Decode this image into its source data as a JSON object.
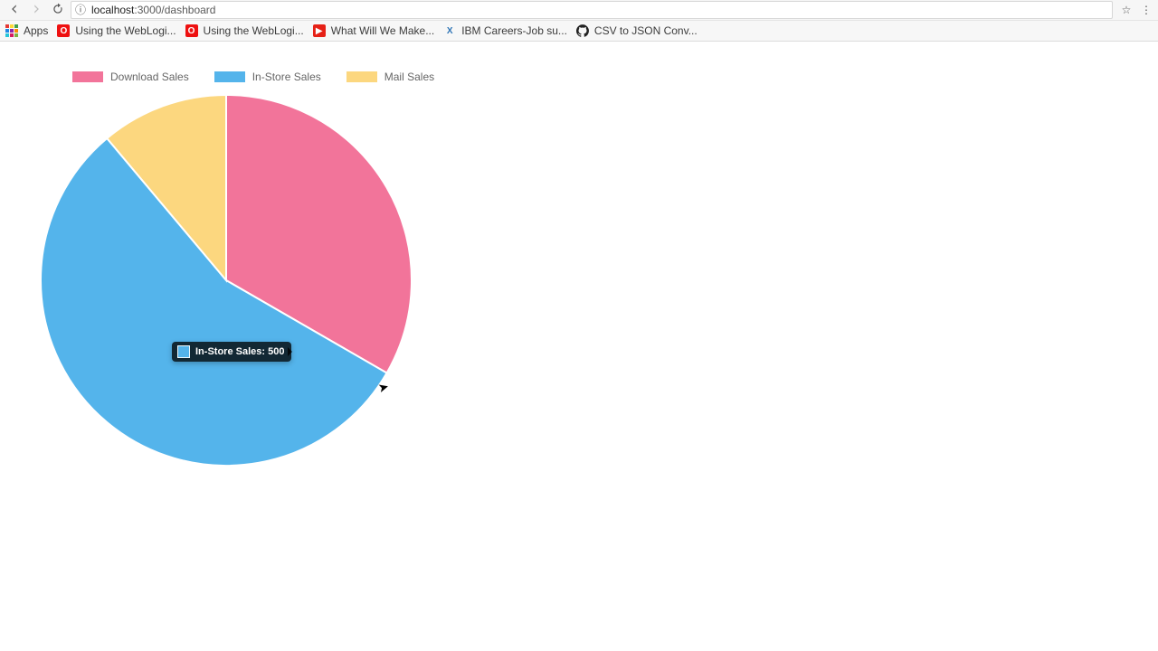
{
  "browser": {
    "url_host": "localhost",
    "url_port_path": ":3000/dashboard",
    "bookmarks": [
      {
        "label": "Apps",
        "kind": "apps"
      },
      {
        "label": "Using the WebLogi...",
        "kind": "oracle"
      },
      {
        "label": "Using the WebLogi...",
        "kind": "oracle"
      },
      {
        "label": "What Will We Make...",
        "kind": "youtube"
      },
      {
        "label": "IBM Careers-Job su...",
        "kind": "x"
      },
      {
        "label": "CSV to JSON Conv...",
        "kind": "github"
      }
    ]
  },
  "legend": [
    {
      "label": "Download Sales",
      "color": "#f2749a"
    },
    {
      "label": "In-Store Sales",
      "color": "#54b4eb"
    },
    {
      "label": "Mail Sales",
      "color": "#fcd77f"
    }
  ],
  "tooltip": {
    "label": "In-Store Sales",
    "value": "500",
    "swatch": "#54b4eb"
  },
  "chart_data": {
    "type": "pie",
    "series": [
      {
        "name": "Download Sales",
        "value": 300,
        "color": "#f2749a"
      },
      {
        "name": "In-Store Sales",
        "value": 500,
        "color": "#54b4eb"
      },
      {
        "name": "Mail Sales",
        "value": 100,
        "color": "#fcd77f"
      }
    ],
    "title": "",
    "xlabel": "",
    "ylabel": ""
  }
}
